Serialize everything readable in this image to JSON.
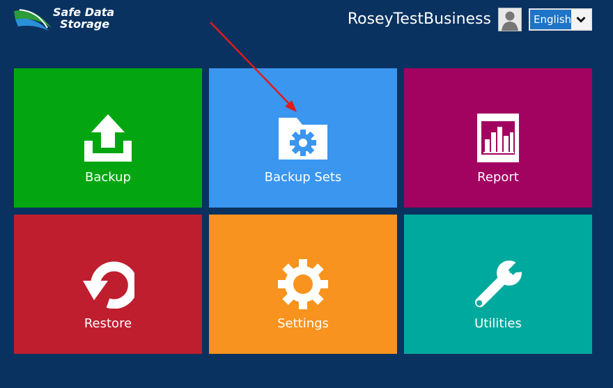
{
  "header": {
    "logo": {
      "line1": "Safe Data",
      "line2": "Storage"
    },
    "username": "RoseyTestBusiness",
    "language": {
      "selected": "English"
    }
  },
  "tiles": [
    {
      "label": "Backup",
      "icon": "upload-icon",
      "color": "#03a611"
    },
    {
      "label": "Backup Sets",
      "icon": "folder-gear-icon",
      "color": "#3a96ef"
    },
    {
      "label": "Report",
      "icon": "report-chart-icon",
      "color": "#a20260"
    },
    {
      "label": "Restore",
      "icon": "restore-icon",
      "color": "#bf1e2e"
    },
    {
      "label": "Settings",
      "icon": "gear-icon",
      "color": "#f7931e"
    },
    {
      "label": "Utilities",
      "icon": "wrench-icon",
      "color": "#00a99d"
    }
  ],
  "colors": {
    "background": "#0a3260",
    "annotation_arrow": "#e01b1b"
  }
}
